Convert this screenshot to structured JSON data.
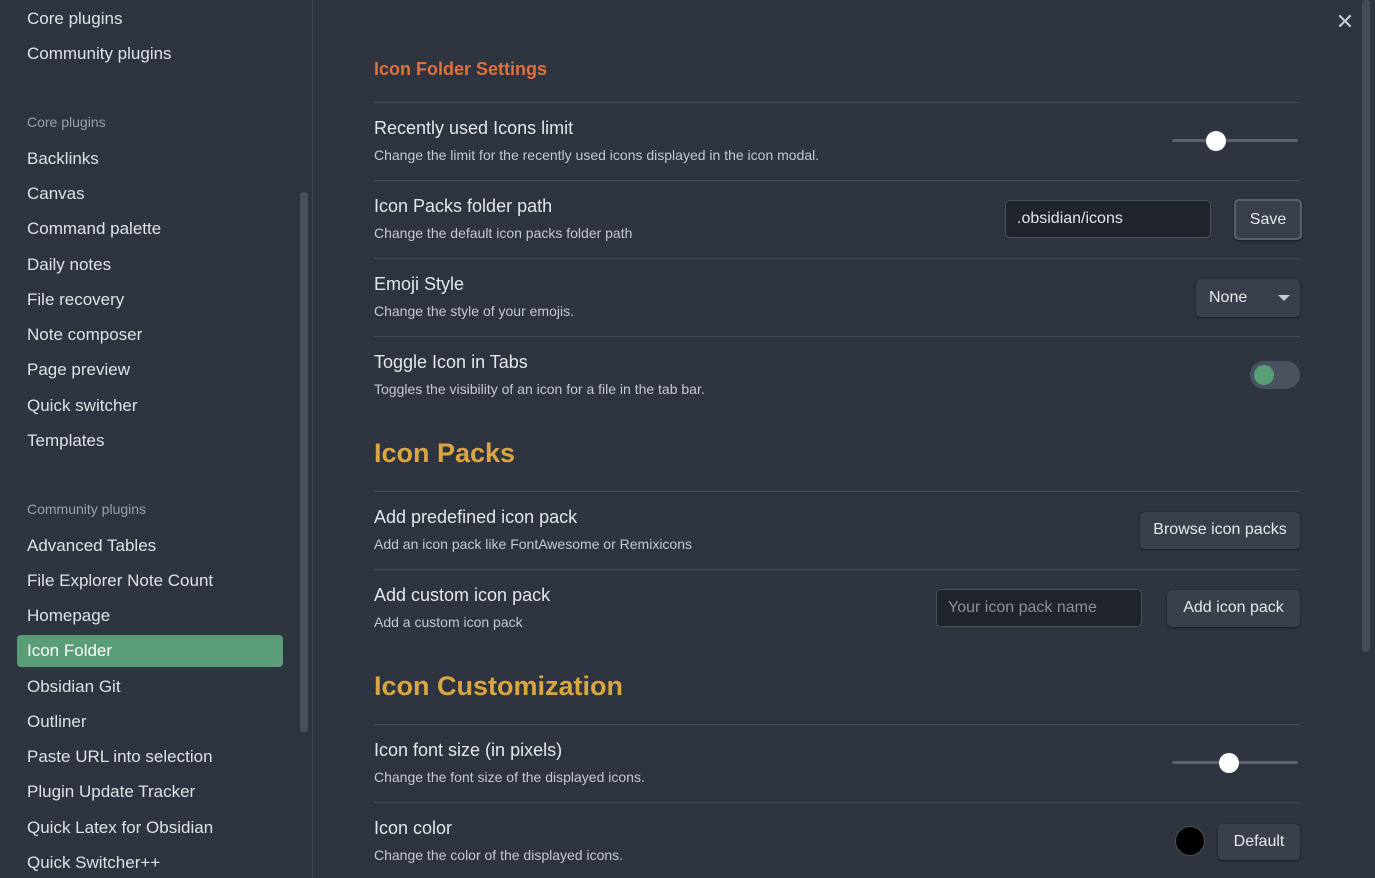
{
  "sidebar": {
    "top_items": [
      "Core plugins",
      "Community plugins"
    ],
    "core_group_label": "Core plugins",
    "core_items": [
      "Backlinks",
      "Canvas",
      "Command palette",
      "Daily notes",
      "File recovery",
      "Note composer",
      "Page preview",
      "Quick switcher",
      "Templates"
    ],
    "community_group_label": "Community plugins",
    "community_items": [
      "Advanced Tables",
      "File Explorer Note Count",
      "Homepage",
      "Icon Folder",
      "Obsidian Git",
      "Outliner",
      "Paste URL into selection",
      "Plugin Update Tracker",
      "Quick Latex for Obsidian",
      "Quick Switcher++"
    ],
    "active_item": "Icon Folder"
  },
  "main": {
    "close_icon": "close-icon",
    "heading_settings": "Icon Folder Settings",
    "recent_limit": {
      "name": "Recently used Icons limit",
      "desc": "Change the limit for the recently used icons displayed in the icon modal.",
      "value_fraction": 0.32
    },
    "folder_path": {
      "name": "Icon Packs folder path",
      "desc": "Change the default icon packs folder path",
      "value": ".obsidian/icons",
      "save_label": "Save"
    },
    "emoji_style": {
      "name": "Emoji Style",
      "desc": "Change the style of your emojis.",
      "selected": "None"
    },
    "toggle_tabs": {
      "name": "Toggle Icon in Tabs",
      "desc": "Toggles the visibility of an icon for a file in the tab bar.",
      "enabled": false
    },
    "heading_packs": "Icon Packs",
    "predefined": {
      "name": "Add predefined icon pack",
      "desc": "Add an icon pack like FontAwesome or Remixicons",
      "button": "Browse icon packs"
    },
    "custom": {
      "name": "Add custom icon pack",
      "desc": "Add a custom icon pack",
      "placeholder": "Your icon pack name",
      "button": "Add icon pack"
    },
    "heading_custom": "Icon Customization",
    "font_size": {
      "name": "Icon font size (in pixels)",
      "desc": "Change the font size of the displayed icons.",
      "value_fraction": 0.44
    },
    "color": {
      "name": "Icon color",
      "desc": "Change the color of the displayed icons.",
      "swatch": "#000000",
      "button": "Default"
    }
  },
  "colors": {
    "accent_active": "#5a9e78",
    "heading_orange": "#e2703a",
    "heading_gold": "#d9a640",
    "background": "#2e3440"
  }
}
